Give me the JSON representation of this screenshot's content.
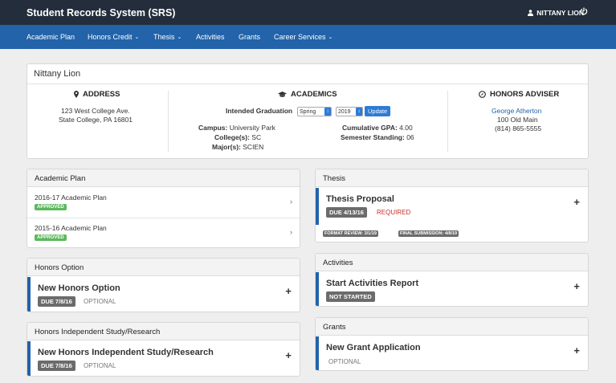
{
  "header": {
    "brand": "Student Records System (SRS)",
    "user_name": "NITTANY LION",
    "user_icon": "user-icon",
    "logout_icon": "power-icon"
  },
  "nav": {
    "items": [
      {
        "label": "Academic Plan",
        "dropdown": false
      },
      {
        "label": "Honors Credit",
        "dropdown": true
      },
      {
        "label": "Thesis",
        "dropdown": true
      },
      {
        "label": "Activities",
        "dropdown": false
      },
      {
        "label": "Grants",
        "dropdown": false
      },
      {
        "label": "Career Services",
        "dropdown": true
      }
    ]
  },
  "profile": {
    "name": "Nittany Lion",
    "address": {
      "title": "ADDRESS",
      "line1": "123 West College Ave.",
      "line2": "State College, PA 16801"
    },
    "academics": {
      "title": "ACADEMICS",
      "intended_graduation_label": "Intended Graduation",
      "term_value": "Spring",
      "year_value": "2019",
      "update_label": "Update",
      "campus_label": "Campus:",
      "campus_value": "University Park",
      "college_label": "College(s):",
      "college_value": "SC",
      "major_label": "Major(s):",
      "major_value": "SCIEN",
      "gpa_label": "Cumulative GPA:",
      "gpa_value": "4.00",
      "standing_label": "Semester Standing:",
      "standing_value": "06"
    },
    "adviser": {
      "title": "HONORS ADVISER",
      "name": "George Atherton",
      "office": "100 Old Main",
      "phone": "(814) 865-5555"
    }
  },
  "academic_plan": {
    "title": "Academic Plan",
    "rows": [
      {
        "label": "2016-17 Academic Plan",
        "status": "APPROVED"
      },
      {
        "label": "2015-16 Academic Plan",
        "status": "APPROVED"
      }
    ]
  },
  "honors_option": {
    "title": "Honors Option",
    "item_title": "New Honors Option",
    "due": "DUE 7/8/16",
    "note": "OPTIONAL"
  },
  "independent_study": {
    "title": "Honors Independent Study/Research",
    "item_title": "New Honors Independent Study/Research",
    "due": "DUE 7/8/16",
    "note": "OPTIONAL"
  },
  "thesis": {
    "title": "Thesis",
    "item_title": "Thesis Proposal",
    "due": "DUE 4/13/16",
    "note": "REQUIRED",
    "format_review": "FORMAT REVIEW: 3/1/19",
    "final_submission": "FINAL SUBMISSION: 4/8/19"
  },
  "activities": {
    "title": "Activities",
    "item_title": "Start Activities Report",
    "status": "NOT STARTED"
  },
  "grants": {
    "title": "Grants",
    "item_title": "New Grant Application",
    "note": "OPTIONAL"
  },
  "colors": {
    "topbar": "#232d3b",
    "navbar": "#2263a9",
    "approved": "#5cb85c",
    "required": "#c9302c"
  }
}
